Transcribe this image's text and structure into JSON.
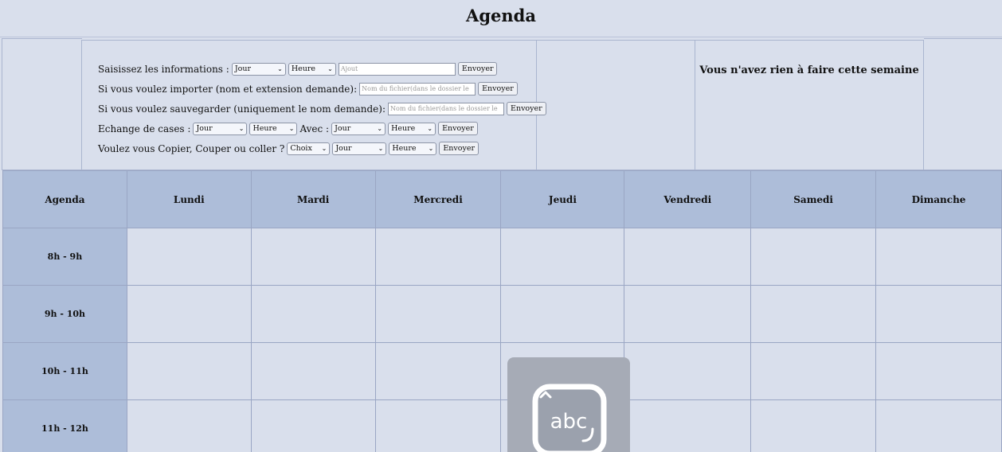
{
  "page": {
    "title": "Agenda"
  },
  "message": "Vous n'avez rien à faire cette semaine",
  "form": {
    "add": {
      "label": "Saisissez les informations :",
      "day": "Jour",
      "hour": "Heure",
      "placeholder": "Ajout",
      "button": "Envoyer"
    },
    "import": {
      "label": "Si vous voulez importer (nom et extension demande):",
      "placeholder": "Nom du fichier(dans le dossier le",
      "button": "Envoyer"
    },
    "save": {
      "label": "Si vous voulez sauvegarder (uniquement le nom demande):",
      "placeholder": "Nom du fichier(dans le dossier le",
      "button": "Envoyer"
    },
    "swap": {
      "label": "Echange de cases :",
      "day1": "Jour",
      "hour1": "Heure",
      "with_label": "Avec :",
      "day2": "Jour",
      "hour2": "Heure",
      "button": "Envoyer"
    },
    "copy": {
      "label": "Voulez vous Copier, Couper ou coller ?",
      "choice": "Choix",
      "day": "Jour",
      "hour": "Heure",
      "button": "Envoyer"
    }
  },
  "table": {
    "corner": "Agenda",
    "days": [
      "Lundi",
      "Mardi",
      "Mercredi",
      "Jeudi",
      "Vendredi",
      "Samedi",
      "Dimanche"
    ],
    "hours": [
      "8h - 9h",
      "9h - 10h",
      "10h - 11h",
      "11h - 12h"
    ]
  },
  "overlay": {
    "icon": "keyboard-abc-icon",
    "text": "abc"
  },
  "colors": {
    "background": "#d9dfec",
    "header": "#adbdd9",
    "border": "#9aa6c4",
    "overlay": "#a6abb6"
  }
}
